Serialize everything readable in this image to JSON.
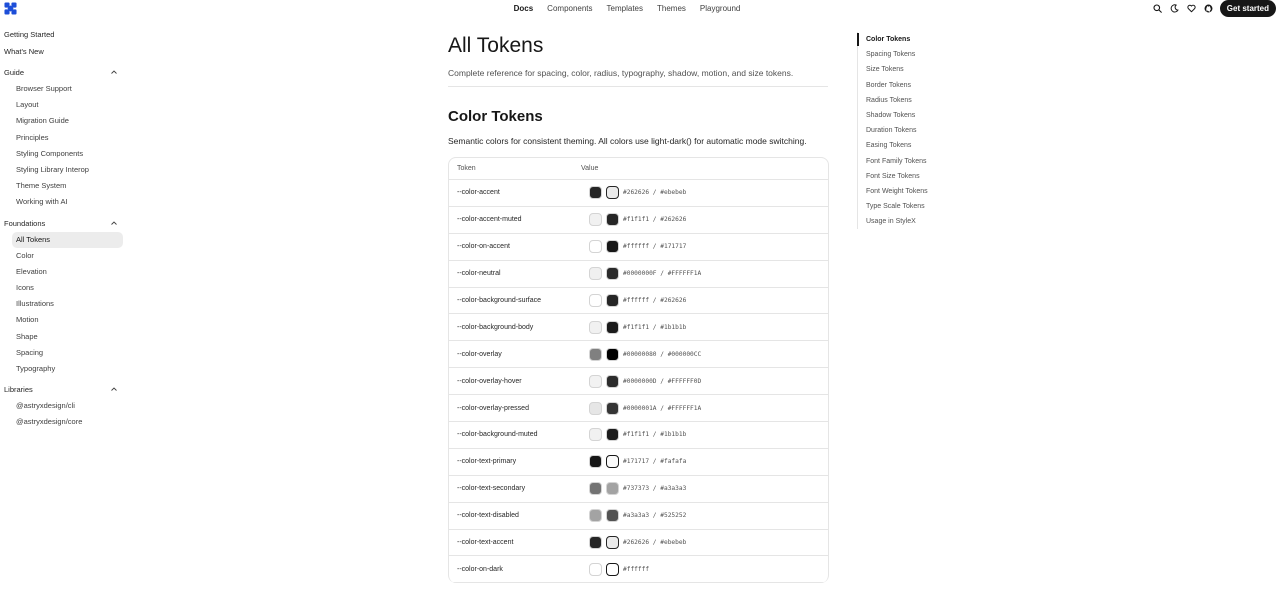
{
  "header": {
    "nav": [
      "Docs",
      "Components",
      "Templates",
      "Themes",
      "Playground"
    ],
    "active_nav": "Docs",
    "cta_label": "Get started",
    "icons": [
      "search-icon",
      "moon-icon",
      "heart-icon",
      "github-icon"
    ],
    "brand_color": "#1d4ed8"
  },
  "sidebar": {
    "top_items": [
      "Getting Started",
      "What's New"
    ],
    "sections": [
      {
        "label": "Guide",
        "items": [
          "Browser Support",
          "Layout",
          "Migration Guide",
          "Principles",
          "Styling Components",
          "Styling Library Interop",
          "Theme System",
          "Working with AI"
        ]
      },
      {
        "label": "Foundations",
        "items": [
          "All Tokens",
          "Color",
          "Elevation",
          "Icons",
          "Illustrations",
          "Motion",
          "Shape",
          "Spacing",
          "Typography"
        ]
      },
      {
        "label": "Libraries",
        "items": [
          "@astryxdesign/cli",
          "@astryxdesign/core"
        ]
      }
    ],
    "active_item": "All Tokens"
  },
  "main": {
    "title": "All Tokens",
    "subtitle": "Complete reference for spacing, color, radius, typography, shadow, motion, and size tokens.",
    "section_title": "Color Tokens",
    "section_desc": "Semantic colors for consistent theming. All colors use light-dark() for automatic mode switching.",
    "table": {
      "headers": [
        "Token",
        "Value"
      ],
      "rows": [
        {
          "token": "--color-accent",
          "value": "#262626 / #ebebeb",
          "light": "#262626",
          "dark": "#ebebeb"
        },
        {
          "token": "--color-accent-muted",
          "value": "#f1f1f1 / #262626",
          "light": "#f1f1f1",
          "dark": "#262626"
        },
        {
          "token": "--color-on-accent",
          "value": "#ffffff / #171717",
          "light": "#ffffff",
          "dark": "#171717"
        },
        {
          "token": "--color-neutral",
          "value": "#0000000F / #FFFFFF1A",
          "light": "#f0f0f0",
          "dark": "#2a2a2a"
        },
        {
          "token": "--color-background-surface",
          "value": "#ffffff / #262626",
          "light": "#ffffff",
          "dark": "#262626"
        },
        {
          "token": "--color-background-body",
          "value": "#f1f1f1 / #1b1b1b",
          "light": "#f1f1f1",
          "dark": "#1b1b1b"
        },
        {
          "token": "--color-overlay",
          "value": "#00000080 / #000000CC",
          "light": "#808080",
          "dark": "#000000"
        },
        {
          "token": "--color-overlay-hover",
          "value": "#0000000D / #FFFFFF0D",
          "light": "#f2f2f2",
          "dark": "#2c2c2c"
        },
        {
          "token": "--color-overlay-pressed",
          "value": "#0000001A / #FFFFFF1A",
          "light": "#e6e6e6",
          "dark": "#353535"
        },
        {
          "token": "--color-background-muted",
          "value": "#f1f1f1 / #1b1b1b",
          "light": "#f1f1f1",
          "dark": "#1b1b1b"
        },
        {
          "token": "--color-text-primary",
          "value": "#171717 / #fafafa",
          "light": "#171717",
          "dark": "#fafafa"
        },
        {
          "token": "--color-text-secondary",
          "value": "#737373 / #a3a3a3",
          "light": "#737373",
          "dark": "#a3a3a3"
        },
        {
          "token": "--color-text-disabled",
          "value": "#a3a3a3 / #525252",
          "light": "#a3a3a3",
          "dark": "#525252"
        },
        {
          "token": "--color-text-accent",
          "value": "#262626 / #ebebeb",
          "light": "#262626",
          "dark": "#ebebeb"
        },
        {
          "token": "--color-on-dark",
          "value": "#ffffff",
          "light": "#ffffff",
          "dark": "#ffffff"
        }
      ]
    }
  },
  "toc": {
    "items": [
      "Color Tokens",
      "Spacing Tokens",
      "Size Tokens",
      "Border Tokens",
      "Radius Tokens",
      "Shadow Tokens",
      "Duration Tokens",
      "Easing Tokens",
      "Font Family Tokens",
      "Font Size Tokens",
      "Font Weight Tokens",
      "Type Scale Tokens",
      "Usage in StyleX"
    ],
    "active": "Color Tokens"
  }
}
